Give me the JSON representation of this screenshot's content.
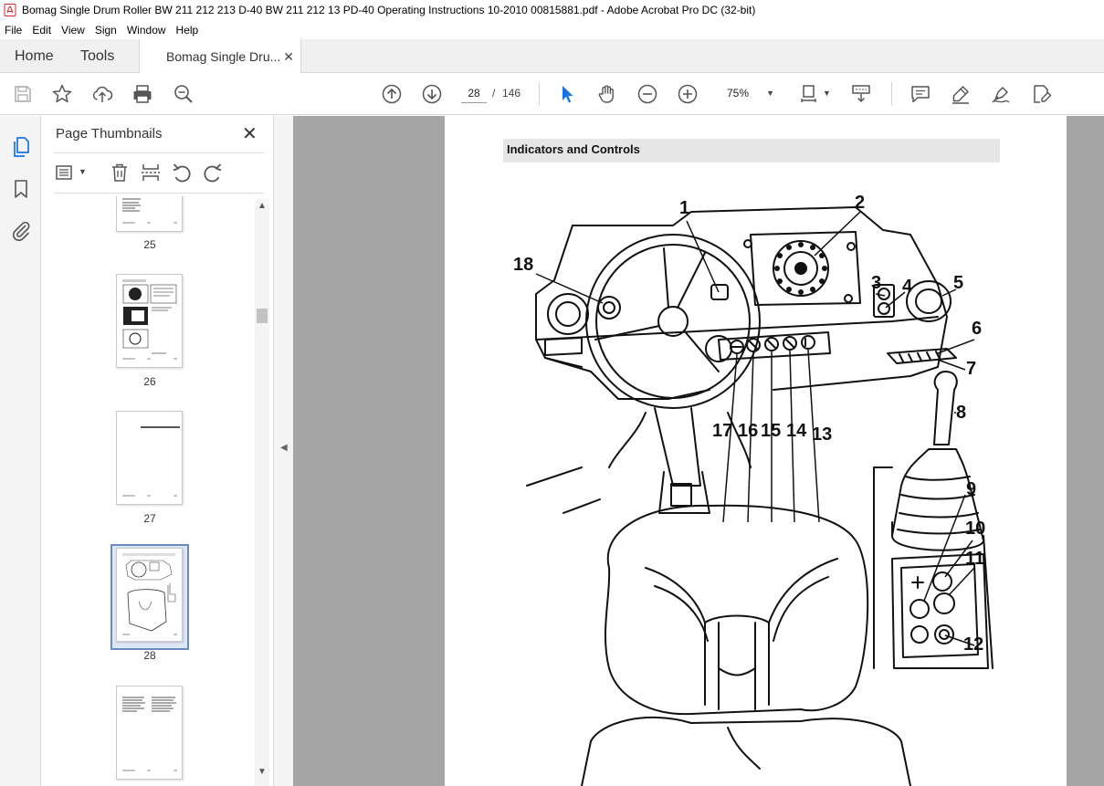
{
  "window": {
    "title": "Bomag Single Drum Roller BW 211 212 213 D-40 BW 211 212 13 PD-40 Operating Instructions 10-2010 00815881.pdf - Adobe Acrobat Pro DC (32-bit)"
  },
  "menu": [
    "File",
    "Edit",
    "View",
    "Sign",
    "Window",
    "Help"
  ],
  "tabs": {
    "home": "Home",
    "tools": "Tools",
    "document": "Bomag Single Dru..."
  },
  "toolbar": {
    "current_page": "28",
    "page_separator": "/",
    "total_pages": "146",
    "zoom": "75%"
  },
  "thumbnails_panel": {
    "title": "Page Thumbnails",
    "pages": [
      {
        "label": "25"
      },
      {
        "label": "26"
      },
      {
        "label": "27"
      },
      {
        "label": "28",
        "selected": true
      },
      {
        "label": ""
      }
    ]
  },
  "document": {
    "heading": "Indicators and Controls",
    "callouts": [
      "1",
      "2",
      "3",
      "4",
      "5",
      "6",
      "7",
      "8",
      "9",
      "10",
      "11",
      "12",
      "13",
      "14",
      "15",
      "16",
      "17",
      "18"
    ]
  },
  "colors": {
    "accent_blue": "#1473e6",
    "acrobat_red": "#d7282f",
    "document_bg": "#a5a5a5"
  }
}
